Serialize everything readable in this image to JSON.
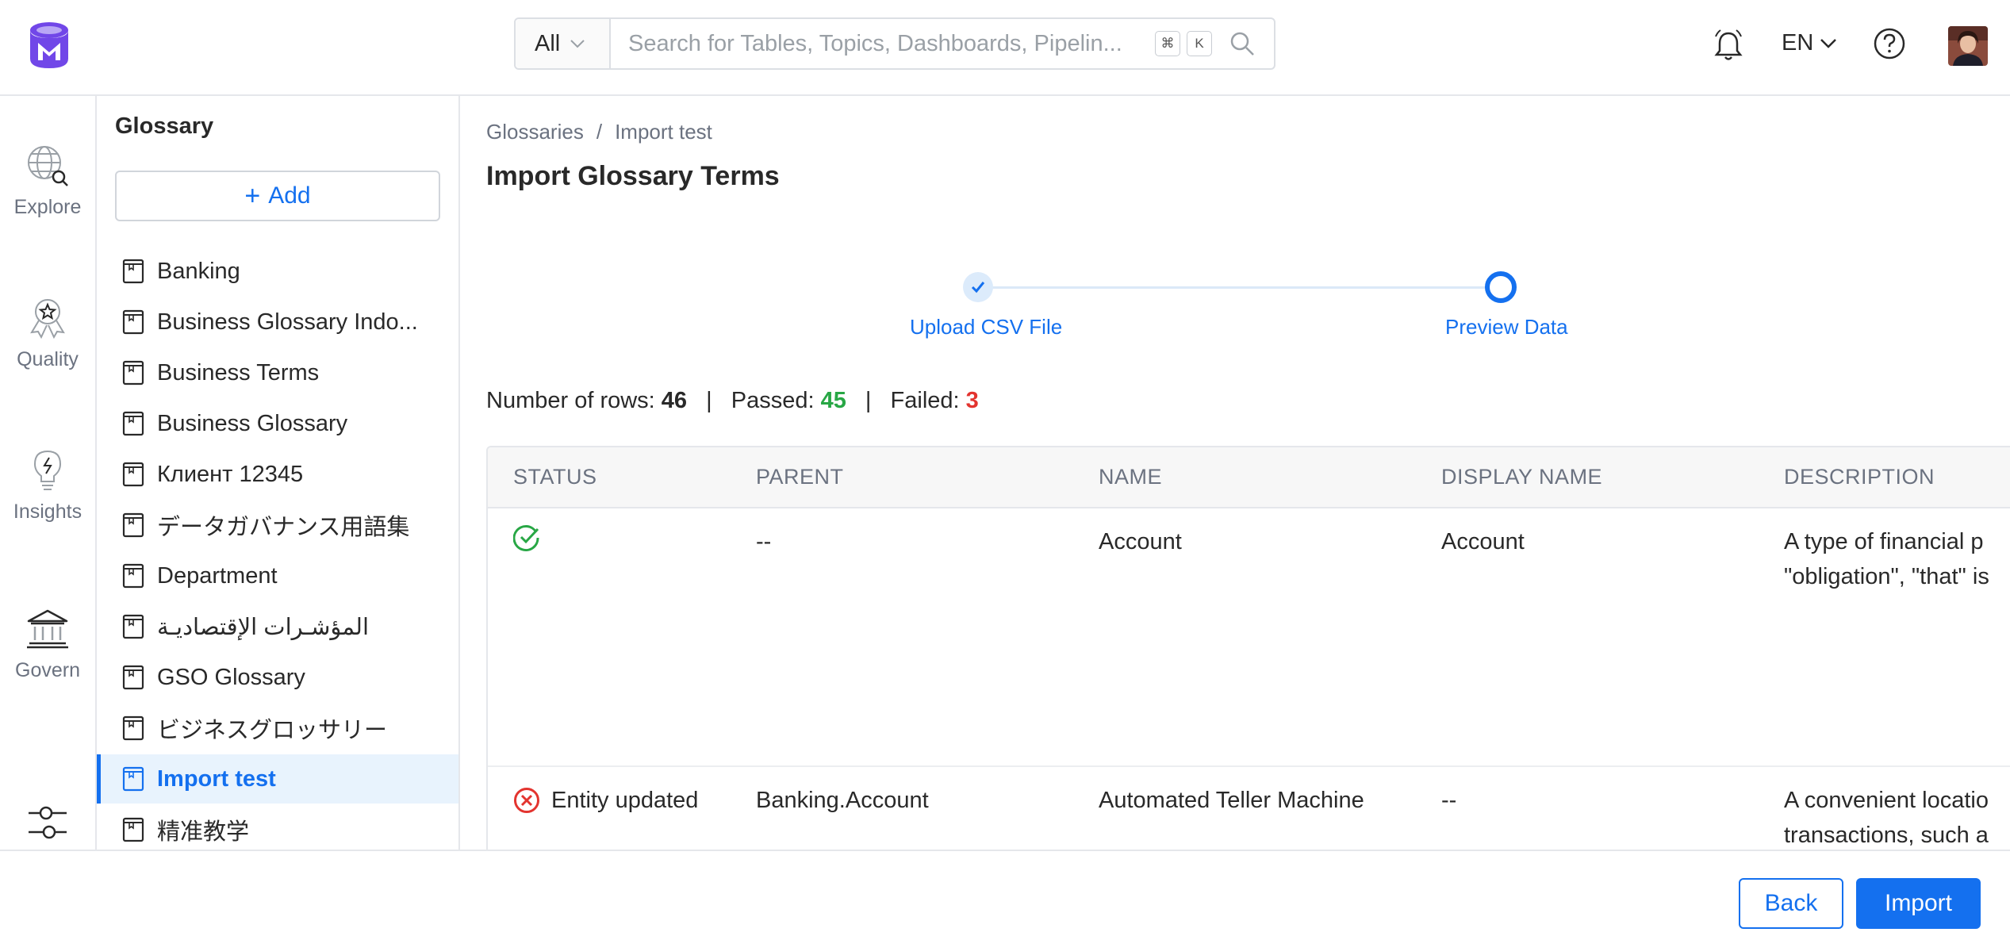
{
  "app": {
    "logo_icon": "metadata-logo-icon",
    "accent": "#1470ef"
  },
  "header": {
    "search_type": "All",
    "search_placeholder": "Search for Tables, Topics, Dashboards, Pipelin...",
    "shortcut_keys": [
      "⌘",
      "K"
    ],
    "language": "EN"
  },
  "leftnav": {
    "items": [
      {
        "label": "Explore",
        "icon": "explore-icon"
      },
      {
        "label": "Quality",
        "icon": "quality-icon"
      },
      {
        "label": "Insights",
        "icon": "insights-icon"
      },
      {
        "label": "Govern",
        "icon": "govern-icon"
      }
    ]
  },
  "glossary_panel": {
    "title": "Glossary",
    "add_label": "Add",
    "items": [
      "Banking",
      "Business Glossary Indo...",
      "Business Terms",
      "Business Glossary",
      "Клиент 12345",
      "データガバナンス用語集",
      "Department",
      "المؤشـرات الإقتصاديـة",
      "GSO Glossary",
      "ビジネスグロッサリー",
      "Import test",
      "精准教学"
    ],
    "active_item": "Import test"
  },
  "breadcrumb": {
    "items": [
      "Glossaries",
      "Import test"
    ],
    "separator": "/"
  },
  "page_title": "Import Glossary Terms",
  "stepper": {
    "steps": [
      {
        "label": "Upload CSV File",
        "state": "completed"
      },
      {
        "label": "Preview Data",
        "state": "current"
      }
    ]
  },
  "summary": {
    "rows_label": "Number of rows:",
    "rows_value": "46",
    "passed_label": "Passed:",
    "passed_value": "45",
    "failed_label": "Failed:",
    "failed_value": "3",
    "separator": "|",
    "passed_color": "#28a745",
    "failed_color": "#e3342f"
  },
  "table": {
    "columns": [
      "STATUS",
      "PARENT",
      "NAME",
      "DISPLAY NAME",
      "DESCRIPTION"
    ],
    "rows": [
      {
        "status_icon": "check-circle-icon",
        "status_text": "",
        "parent": "--",
        "name": "Account",
        "display_name": "Account",
        "description_line1": "A type of financial p",
        "description_line2": "\"obligation\", \"that\" is"
      },
      {
        "status_icon": "x-circle-icon",
        "status_text": "Entity updated",
        "parent": "Banking.Account",
        "name": "Automated Teller Machine",
        "display_name": "--",
        "description_line1": "A convenient locatio",
        "description_line2": "transactions, such a"
      }
    ]
  },
  "footer": {
    "back_label": "Back",
    "import_label": "Import"
  }
}
